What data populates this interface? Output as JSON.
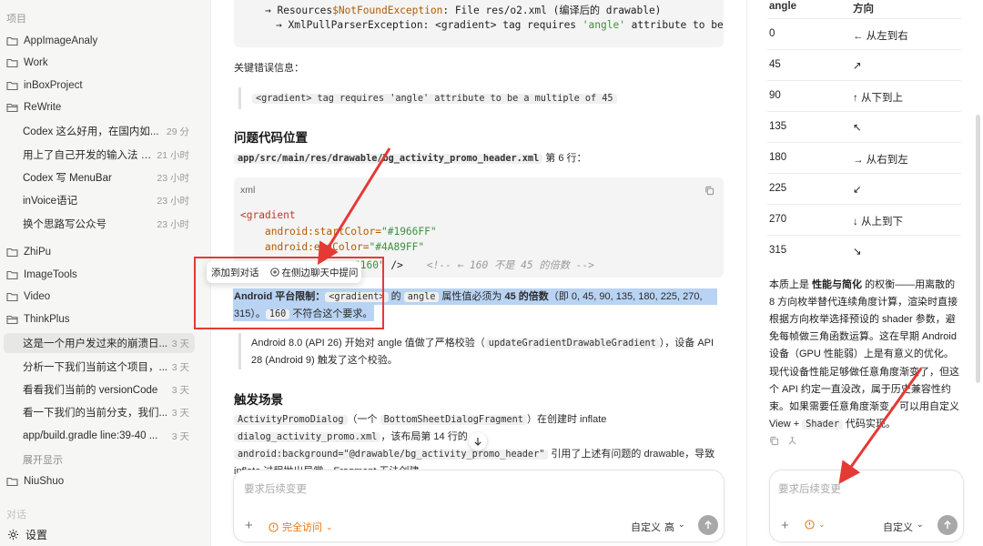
{
  "sidebar": {
    "section_projects": "项目",
    "folders_top": [
      {
        "label": "AppImageAnaly"
      },
      {
        "label": "Work"
      },
      {
        "label": "inBoxProject"
      },
      {
        "label": "ReWrite"
      }
    ],
    "rewrite_convos": [
      {
        "title": "Codex 这么好用，在国内如...",
        "time": "29 分"
      },
      {
        "title": "用上了自己开发的输入法 A...",
        "time": "21 小时"
      },
      {
        "title": "Codex 写 MenuBar",
        "time": "23 小时"
      },
      {
        "title": "inVoice语记",
        "time": "23 小时"
      },
      {
        "title": "换个思路写公众号",
        "time": "23 小时"
      }
    ],
    "folders_mid": [
      {
        "label": "ZhiPu"
      },
      {
        "label": "ImageTools"
      },
      {
        "label": "Video"
      },
      {
        "label": "ThinkPlus"
      }
    ],
    "thinkplus_convos": [
      {
        "title": "这是一个用户发过来的崩溃日...",
        "time": "3 天"
      },
      {
        "title": "分析一下我们当前这个项目，...",
        "time": "3 天"
      },
      {
        "title": "看看我们当前的 versionCode",
        "time": "3 天"
      },
      {
        "title": "看一下我们的当前分支，我们...",
        "time": "3 天"
      },
      {
        "title": "app/build.gradle line:39-40 ...",
        "time": "3 天"
      }
    ],
    "expand_label": "展开显示",
    "folder_niushuo": "NiuShuo",
    "section_chats": "对话",
    "settings_label": "设置"
  },
  "main": {
    "top_code": {
      "line1_a": "→ Resources",
      "line1_b": "$NotFoundException",
      "line1_c": ": File res/o2.xml (编译后的 drawable)",
      "line2_a": "→ XmlPullParserException: <gradient> tag requires ",
      "line2_b": "'angle'",
      "line2_c": " attribute to be"
    },
    "key_error_label": "关键错误信息：",
    "key_error_quote": "<gradient> tag requires 'angle' attribute to be a multiple of 45",
    "section_problem": "问题代码位置",
    "file_path": "app/src/main/res/drawable/bg_activity_promo_header.xml",
    "line_ref": "第 6 行：",
    "code_lang": "xml",
    "code": {
      "l1": "<gradient",
      "l2_attr": "android:startColor=",
      "l2_val": "\"#1966FF\"",
      "l3_attr": "android:endColor=",
      "l3_val": "\"#4A89FF\"",
      "l4_val": "\"160\"",
      "l4_tail": " />",
      "l4_comment": "<!-- ← 160 不是 45 的倍数 -->"
    },
    "popup": {
      "add_to_chat": "添加到对话",
      "ask_side": "在侧边聊天中提问"
    },
    "platform_limit": {
      "bold": "Android 平台限制：",
      "code1": "<gradient>",
      "text1": " 的 ",
      "code2": "angle",
      "text2": " 属性值必须为 ",
      "bold2": "45 的倍数",
      "text3": "（即 0, 45, 90, 135, 180, 225, 270,",
      "text4": "315）。",
      "code3": "160",
      "text5": " 不符合这个要求。"
    },
    "note": {
      "text1": "Android 8.0 (API 26) 开始对 angle 值做了严格校验（",
      "code": "updateGradientDrawableGradient",
      "text2": "），设备 API",
      "text3": "28 (Android 9) 触发了这个校验。"
    },
    "section_trigger": "触发场景",
    "trigger": {
      "code1": "ActivityPromoDialog",
      "t1": "（一个 ",
      "code2": "BottomSheetDialogFragment",
      "t2": "）在创建时 inflate",
      "code3": "dialog_activity_promo.xml",
      "t3": "，该布局第 14 行的",
      "code4": "android:background=\"@drawable/bg_activity_promo_header\"",
      "t4": " 引用了上述有问题的 drawable，导致",
      "t5": "inflate 过程抛出异常，Fragment 无法创建。"
    },
    "composer": {
      "placeholder": "要求后续变更",
      "access_label": "完全访问",
      "model_label": "自定义",
      "effort_label": "高"
    }
  },
  "right": {
    "table_headers": [
      "angle",
      "方向"
    ],
    "table_rows": [
      {
        "angle": "0",
        "dir": "← 从左到右"
      },
      {
        "angle": "45",
        "dir": "↗"
      },
      {
        "angle": "90",
        "dir": "↑ 从下到上"
      },
      {
        "angle": "135",
        "dir": "↖"
      },
      {
        "angle": "180",
        "dir": "→ 从右到左"
      },
      {
        "angle": "225",
        "dir": "↙"
      },
      {
        "angle": "270",
        "dir": "↓ 从上到下"
      },
      {
        "angle": "315",
        "dir": "↘"
      }
    ],
    "para1": {
      "a": "本质上是 ",
      "b": "性能与简化",
      "c": " 的权衡——用离散的",
      "l2": "8 方向枚举替代连续角度计算，渲染时直接",
      "l3": "根据方向枚举选择预设的 shader 参数，避",
      "l4": "免每帧做三角函数运算。这在早期 Android",
      "l5": "设备（GPU 性能弱）上是有意义的优化。"
    },
    "para2": {
      "l1": "现代设备性能足够做任意角度渐变了，但这",
      "l2": "个 API 约定一直没改，属于历史兼容性约",
      "l3": "束。如果需要任意角度渐变，可以用自定义",
      "l4a": "View + ",
      "l4code": "Shader",
      "l4b": " 代码实现。"
    },
    "composer": {
      "placeholder": "要求后续变更",
      "model_label": "自定义"
    }
  },
  "colors": {
    "annotation_red": "#e53935",
    "selection_blue": "#b9d3f3",
    "access_orange": "#e8710a"
  }
}
